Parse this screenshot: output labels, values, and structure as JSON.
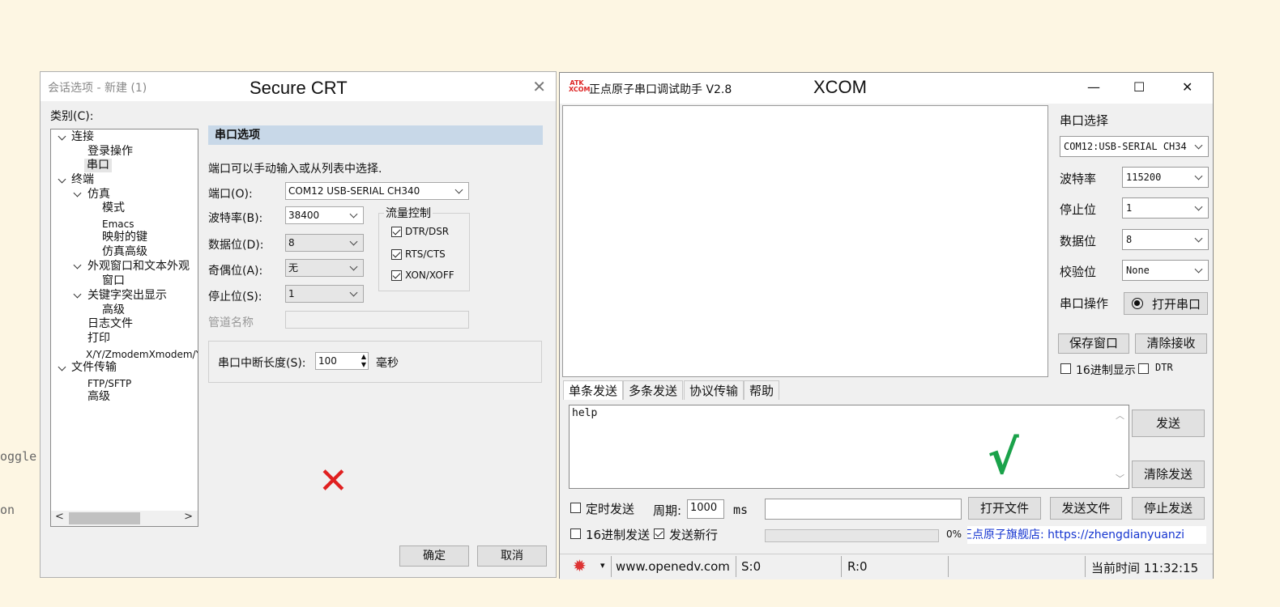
{
  "background_fragments": {
    "frag1": "oggle",
    "frag2": "on"
  },
  "securecrt": {
    "window_title": "会话选项 - 新建 (1)",
    "overlay_label": "Secure CRT",
    "close_glyph": "✕",
    "category_label": "类别(C):",
    "tree": [
      {
        "label": "连接",
        "level": 0,
        "expanded": true
      },
      {
        "label": "登录操作",
        "level": 1
      },
      {
        "label": "串口",
        "level": 1,
        "selected": true
      },
      {
        "label": "终端",
        "level": 0,
        "expanded": true
      },
      {
        "label": "仿真",
        "level": 1,
        "expanded": true
      },
      {
        "label": "模式",
        "level": 2
      },
      {
        "label": "Emacs",
        "level": 2
      },
      {
        "label": "映射的键",
        "level": 2
      },
      {
        "label": "仿真高级",
        "level": 2
      },
      {
        "label": "外观窗口和文本外观",
        "level": 1,
        "expanded": true
      },
      {
        "label": "窗口",
        "level": 2
      },
      {
        "label": "关键字突出显示",
        "level": 1,
        "expanded": true
      },
      {
        "label": "高级",
        "level": 2
      },
      {
        "label": "日志文件",
        "level": 1
      },
      {
        "label": "打印",
        "level": 1
      },
      {
        "label": "X/Y/ZmodemXmodem/Y",
        "level": 1
      },
      {
        "label": "文件传输",
        "level": 0,
        "expanded": true
      },
      {
        "label": "FTP/SFTP",
        "level": 1
      },
      {
        "label": "高级",
        "level": 1
      }
    ],
    "section_header": "串口选项",
    "description": "端口可以手动输入或从列表中选择.",
    "port_label": "端口(O):",
    "port_value": "COM12 USB-SERIAL CH340",
    "baud_label": "波特率(B):",
    "baud_value": "38400",
    "databits_label": "数据位(D):",
    "databits_value": "8",
    "parity_label": "奇偶位(A):",
    "parity_value": "无",
    "stopbits_label": "停止位(S):",
    "stopbits_value": "1",
    "pipe_label": "管道名称",
    "pipe_value": "",
    "flow_title": "流量控制",
    "flow_options": [
      {
        "label": "DTR/DSR",
        "checked": true
      },
      {
        "label": "RTS/CTS",
        "checked": true
      },
      {
        "label": "XON/XOFF",
        "checked": true
      }
    ],
    "break_label": "串口中断长度(S):",
    "break_value": "100",
    "break_unit": "毫秒",
    "ok_label": "确定",
    "cancel_label": "取消",
    "mark": "✕",
    "mark_color": "#e02020"
  },
  "xcom": {
    "logo_text": "ATK XCOM",
    "window_title": "正点原子串口调试助手 V2.8",
    "overlay_label": "XCOM",
    "minimize_glyph": "—",
    "maximize_glyph": "☐",
    "close_glyph": "✕",
    "port_select_label": "串口选择",
    "port_value": "COM12:USB-SERIAL CH34",
    "baud_label": "波特率",
    "baud_value": "115200",
    "stopbit_label": "停止位",
    "stopbit_value": "1",
    "databit_label": "数据位",
    "databit_value": "8",
    "parity_label": "校验位",
    "parity_value": "None",
    "op_label": "串口操作",
    "open_btn": "打开串口",
    "save_window_btn": "保存窗口",
    "clear_recv_btn": "清除接收",
    "hex_display_label": "16进制显示",
    "hex_display_checked": false,
    "dtr_label": "DTR",
    "dtr_checked": false,
    "tabs": [
      "单条发送",
      "多条发送",
      "协议传输",
      "帮助"
    ],
    "send_text": "help",
    "send_btn": "发送",
    "clear_send_btn": "清除发送",
    "timed_send_label": "定时发送",
    "timed_send_checked": false,
    "period_label": "周期:",
    "period_value": "1000",
    "period_unit": "ms",
    "file_path_value": "",
    "open_file_btn": "打开文件",
    "send_file_btn": "发送文件",
    "stop_send_btn": "停止发送",
    "hex_send_label": "16进制发送",
    "hex_send_checked": false,
    "newline_label": "发送新行",
    "newline_checked": true,
    "progress_text": "0%",
    "progress_value": 0,
    "ad_text": "正点原子旗舰店: https://zhengdianyuanzi",
    "check_mark": "√",
    "check_color": "#1aa24a",
    "status": {
      "gear_glyph": "✹",
      "menu_glyph": "▾",
      "website": "www.openedv.com",
      "sent": "S:0",
      "received": "R:0",
      "time": "当前时间 11:32:15"
    }
  }
}
